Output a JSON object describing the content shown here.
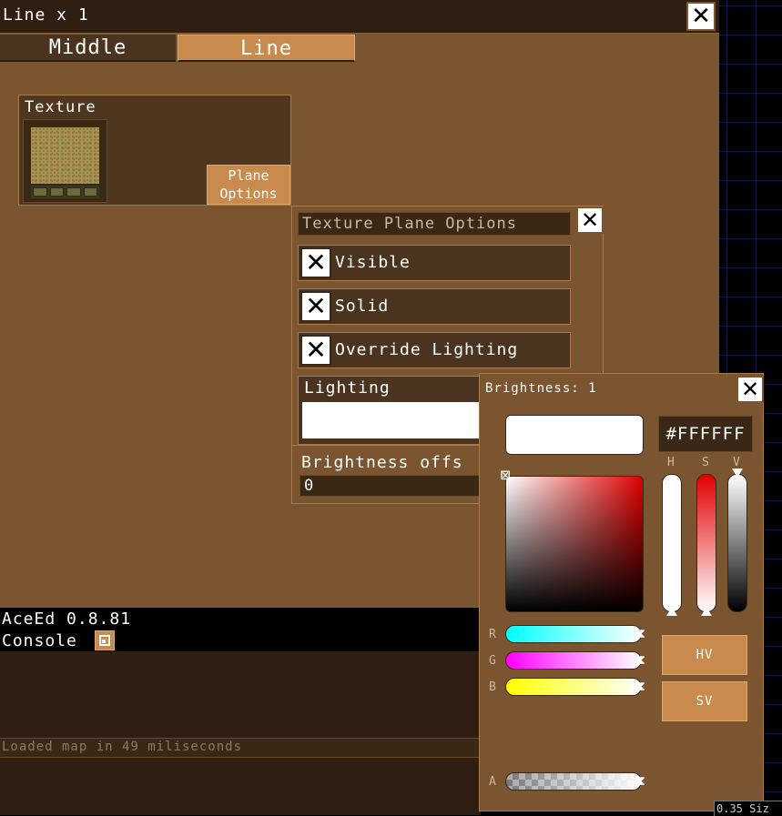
{
  "window": {
    "title": "Line x 1",
    "close_icon": "close-icon"
  },
  "tabs": [
    {
      "label": "Middle",
      "active": false
    },
    {
      "label": "Line",
      "active": true
    }
  ],
  "texture_panel": {
    "label": "Texture",
    "plane_options_label": "Plane\nOptions"
  },
  "texture_plane_options": {
    "title": "Texture Plane Options",
    "checkboxes": [
      {
        "label": "Visible",
        "checked": true
      },
      {
        "label": "Solid",
        "checked": true
      },
      {
        "label": "Override Lighting",
        "checked": true
      }
    ],
    "lighting_label": "Lighting",
    "lighting_color": "#FFFFFF",
    "brightness_label": "Brightness offs",
    "brightness_value": "0"
  },
  "console": {
    "version": "AceEd 0.8.81",
    "label": "Console",
    "log": "Loaded map in 49 miliseconds"
  },
  "color_picker": {
    "title": "Brightness: 1",
    "hex": "#FFFFFF",
    "axis_labels": {
      "h": "H",
      "s": "S",
      "v": "V"
    },
    "channel_labels": {
      "r": "R",
      "g": "G",
      "b": "B",
      "a": "A"
    },
    "buttons": {
      "hv": "HV",
      "sv": "SV"
    },
    "selected_color": "#FFFFFF"
  },
  "status_fragment": "0.35 Siz",
  "colors": {
    "panel_bg": "#7a5530",
    "dark_bg": "#2e1f12",
    "accent": "#c98a4e"
  }
}
